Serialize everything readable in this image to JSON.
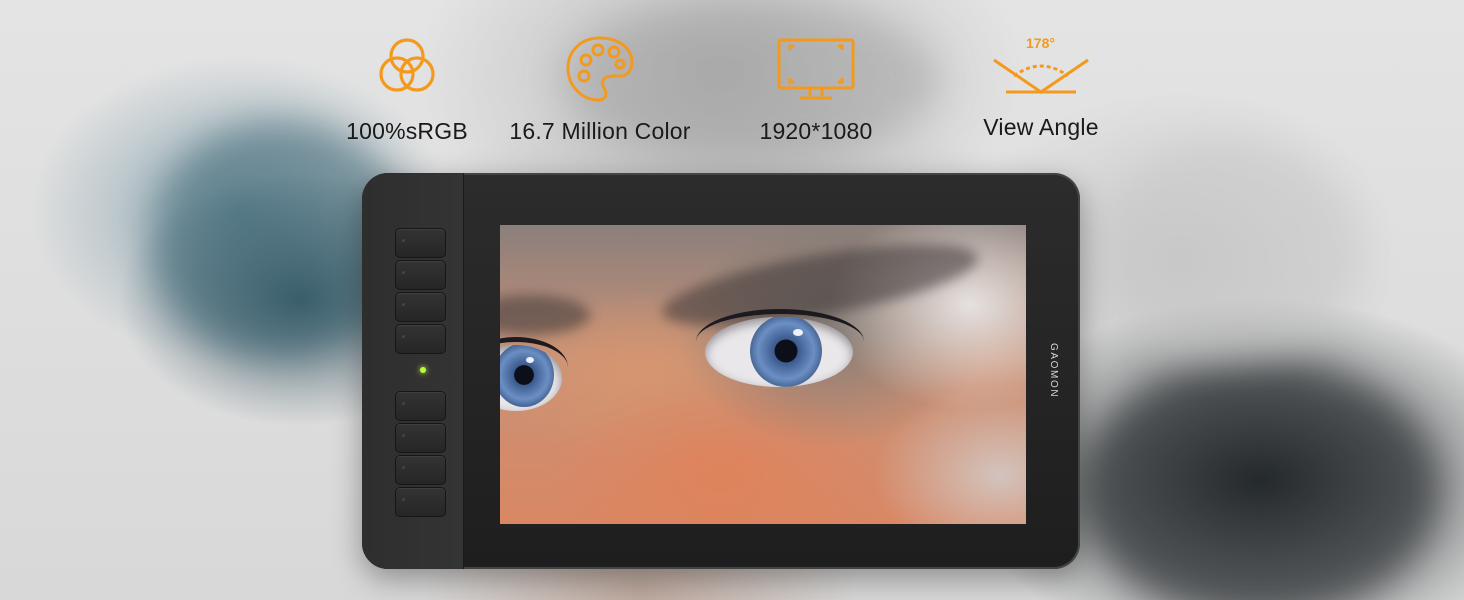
{
  "features": [
    {
      "icon": "rgb-circles-icon",
      "label": "100%sRGB"
    },
    {
      "icon": "color-palette-icon",
      "label": "16.7 Million Color"
    },
    {
      "icon": "monitor-icon",
      "label": "1920*1080"
    },
    {
      "icon": "view-angle-icon",
      "label": "View Angle",
      "angle_text": "178°"
    }
  ],
  "tablet": {
    "brand": "GAOMON",
    "led_color": "#b9ff3a"
  },
  "colors": {
    "icon_orange": "#f39a1e",
    "label_text": "#1a1a1a",
    "tablet_body": "#2a2a2a"
  }
}
